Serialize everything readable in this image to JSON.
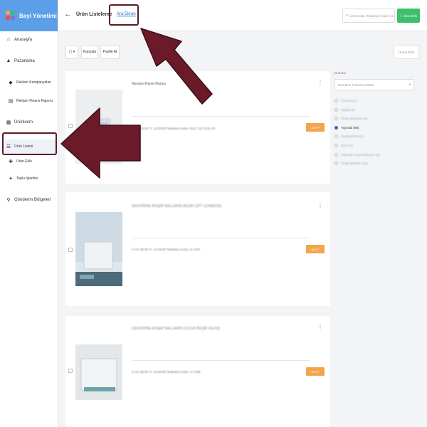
{
  "brand": {
    "title": "Bayi Yönetimi"
  },
  "sidebar": {
    "items": [
      {
        "label": "Anasayfa",
        "icon": "home-icon"
      },
      {
        "label": "Pazarlama",
        "icon": "bell-icon"
      },
      {
        "label": "Reklam Kampanyaları",
        "icon": "tag-icon"
      },
      {
        "label": "Reklam Finans Raporu",
        "icon": "report-icon"
      },
      {
        "label": "Ürünlerim",
        "icon": "grid-icon"
      },
      {
        "label": "Ürün Listesi",
        "icon": "list-icon"
      },
      {
        "label": "Ürün Ekle",
        "icon": "plus-icon"
      },
      {
        "label": "Toplu İşlemler",
        "icon": "layers-icon"
      },
      {
        "label": "Gönderim Bölgeleri",
        "icon": "location-icon"
      }
    ]
  },
  "topbar": {
    "back_glyph": "←",
    "title": "Ürün Listeleme",
    "tab_link": "Ara Ekran",
    "search_placeholder": "Ürün Kodu, Tedarikçi Kodu Ara",
    "add_button": "Ürün Ekle"
  },
  "toolbar": {
    "dropdown_glyph": "▢ ▾",
    "copy": "Kopyala",
    "passive": "Pasife Al",
    "right_button": "Ürünü Ekle"
  },
  "products": [
    {
      "name": "Novussi Panel Ranza",
      "meta": "Ü Gri      28,00 TL      1/1/2020      Tedarikçi Kodu: 4101 123 1011 40",
      "badge": "AKTİF"
    },
    {
      "name": "DEKORPAE AHŞAP BALLARIN BEŞİK ÇİFT LENMEDEL",
      "meta": "Ü Gri      28,00 TL      1/1/2020      Tedarikçi Kodu: cr-1437",
      "badge": "AKTİF"
    },
    {
      "name": "DEKORPAE AHŞAP BALLARIN ÇOCUK BEŞİK 40x100",
      "meta": "Ü Gri      28,00 TL      1/1/2020      Tedarikçi Kodu: cr-1438",
      "badge": "AKTİF"
    }
  ],
  "filter": {
    "title": "Durumu",
    "select_value": "Ürünlerin Tümünü Göster",
    "options": [
      {
        "label": "Tümü (111)",
        "selected": false
      },
      {
        "label": "Taslak (6)",
        "selected": false
      },
      {
        "label": "Onay Bekleyen (5)",
        "selected": false
      },
      {
        "label": "Yayında (98)",
        "selected": true
      },
      {
        "label": "Reddedilmiş (3)",
        "selected": false
      },
      {
        "label": "Pasif (0)",
        "selected": false
      },
      {
        "label": "Yayında Onay Bekleyen (0)",
        "selected": false
      },
      {
        "label": "Stoğu Bitenler (26)",
        "selected": false
      }
    ]
  },
  "colors": {
    "brand": "#5c9ee8",
    "accent": "#3ebf6b",
    "badge": "#f4a54a",
    "annotation": "#6b1a2a"
  }
}
